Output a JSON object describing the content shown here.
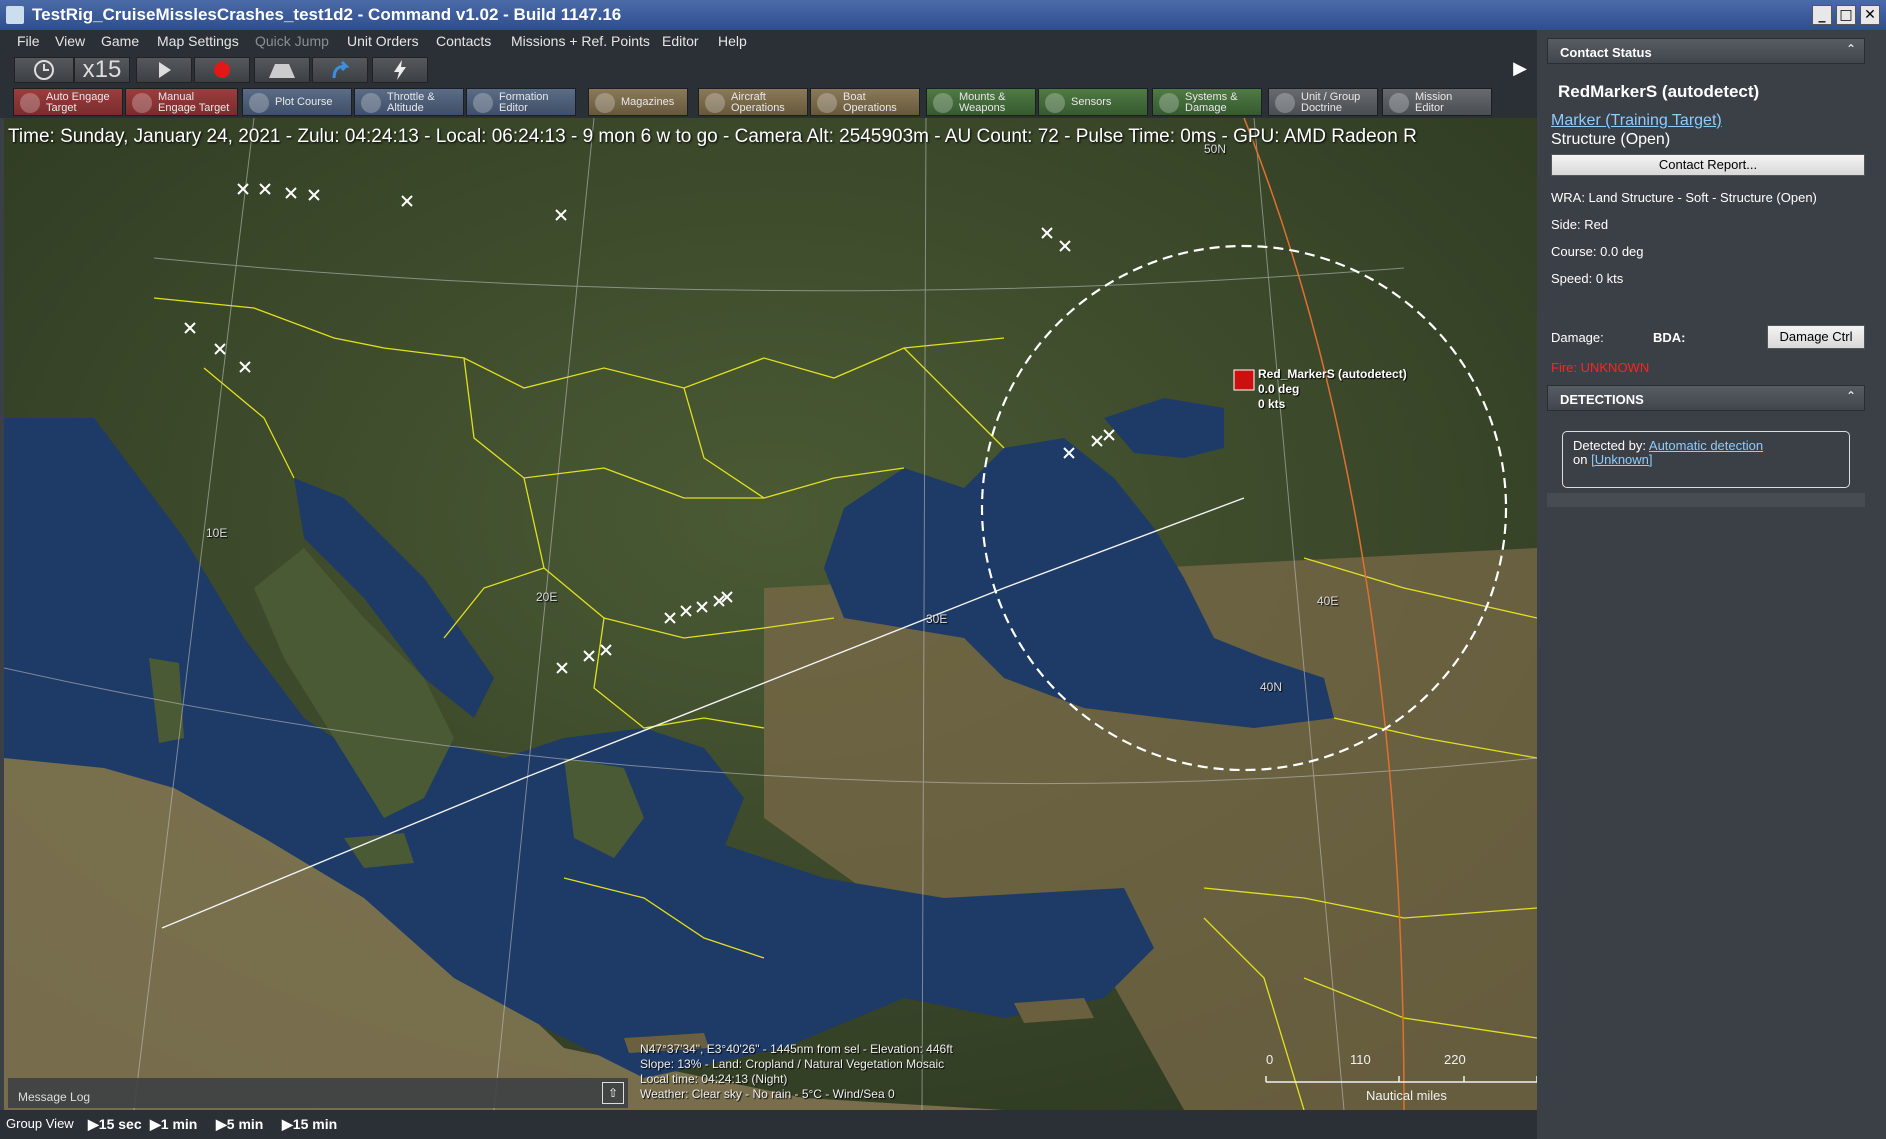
{
  "window": {
    "title": "TestRig_CruiseMisslesCrashes_test1d2 - Command v1.02 - Build 1147.16",
    "buttons": [
      "_",
      "□",
      "✕"
    ]
  },
  "menu": {
    "items": [
      {
        "label": "File"
      },
      {
        "label": "View"
      },
      {
        "label": "Game"
      },
      {
        "label": "Map Settings"
      },
      {
        "label": "Quick Jump"
      },
      {
        "label": "Unit Orders"
      },
      {
        "label": "Contacts"
      },
      {
        "label": "Missions + Ref. Points"
      },
      {
        "label": "Editor"
      },
      {
        "label": "Help"
      }
    ]
  },
  "time_controls": {
    "compression": "x15"
  },
  "toolbar": {
    "buttons": [
      {
        "label": "Auto Engage\nTarget"
      },
      {
        "label": "Manual\nEngage Target"
      },
      {
        "label": "Plot Course"
      },
      {
        "label": "Throttle &\nAltitude"
      },
      {
        "label": "Formation\nEditor"
      },
      {
        "label": "Magazines"
      },
      {
        "label": "Aircraft\nOperations"
      },
      {
        "label": "Boat\nOperations"
      },
      {
        "label": "Mounts &\nWeapons"
      },
      {
        "label": "Sensors"
      },
      {
        "label": "Systems &\nDamage"
      },
      {
        "label": "Unit / Group\nDoctrine"
      },
      {
        "label": "Mission\nEditor"
      }
    ]
  },
  "map": {
    "hud": "Time: Sunday, January 24, 2021 - Zulu: 04:24:13 - Local: 06:24:13 - 9 mon 6 w to go -  Camera Alt: 2545903m  - AU Count: 72 - Pulse Time: 0ms - GPU: AMD Radeon R",
    "grid_labels": {
      "lon10": "10E",
      "lon20": "20E",
      "lon30": "30E",
      "lon40": "40E",
      "lat40": "40N",
      "lat50": "50N"
    },
    "unit": {
      "name": "Red_MarkerS (autodetect)",
      "course": "0.0 deg",
      "speed": "0 kts"
    },
    "cursor_info": [
      "N47°37'34\", E3°40'26\" - 1445nm from sel - Elevation: 446ft",
      "Slope: 13%  - Land: Cropland / Natural Vegetation Mosaic",
      "Local time: 04:24:13 (Night)",
      "Weather: Clear sky - No rain - 5°C - Wind/Sea 0"
    ],
    "scale": {
      "ticks": [
        "0",
        "110",
        "220"
      ],
      "units": "Nautical miles"
    },
    "message_log": "Message Log"
  },
  "status_bar": {
    "group_view": "Group View",
    "steps": [
      "15 sec",
      "1 min",
      "5 min",
      "15 min"
    ]
  },
  "contact_panel": {
    "header": "Contact Status",
    "contact_name": "RedMarkerS (autodetect)",
    "type_link": "Marker (Training Target)",
    "subtype": "Structure (Open)",
    "report_button": "Contact Report...",
    "wra": "WRA: Land Structure - Soft - Structure (Open)",
    "side": "Side: Red",
    "course": "Course: 0.0 deg",
    "speed": "Speed: 0 kts",
    "damage_label": "Damage:",
    "bda_label": "BDA:",
    "damage_button": "Damage Ctrl",
    "fire": "Fire: UNKNOWN",
    "detections_header": "DETECTIONS",
    "detected_by_label": "Detected by:",
    "detected_by_link": "Automatic detection",
    "on_label": "on",
    "on_link": "[Unknown]"
  },
  "colors": {
    "fire_text": "#ff2222",
    "link": "#8ecbff",
    "borders": "#e0e020",
    "sea": "#1e3a66"
  }
}
